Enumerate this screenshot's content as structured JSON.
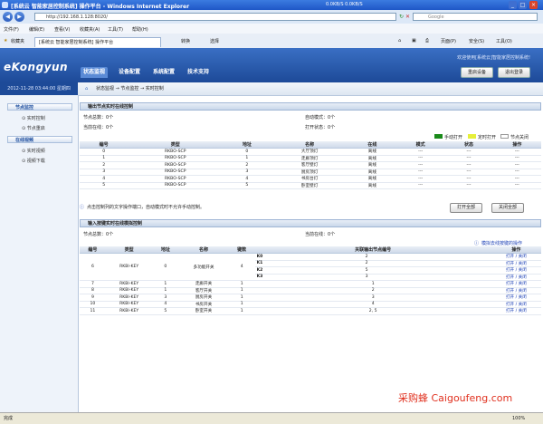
{
  "window": {
    "title": "[系统云 智能家居控制系统] 操作平台 - Windows Internet Explorer",
    "net_status": "0.0KB/S  0.0KB/S"
  },
  "browser": {
    "address": "http://192.168.1.128:8020/",
    "search_placeholder": "Google",
    "menu": [
      "文件(F)",
      "编辑(E)",
      "查看(V)",
      "收藏夹(A)",
      "工具(T)",
      "帮助(H)"
    ],
    "favorites_label": "收藏夹",
    "tab_label": "[系统云 智能家居控制系统] 操作平台",
    "tab_tools": [
      "转换",
      "选择"
    ],
    "toolbar_right": [
      "页面(P)",
      "安全(S)",
      "工具(O)"
    ]
  },
  "app": {
    "logo": "eKongyun",
    "nav": [
      "状态监视",
      "设备配置",
      "系统配置",
      "技术支持"
    ],
    "welcome": "欢迎使用[系统云]智能家居控制系统!",
    "buttons": {
      "restart": "重启设备",
      "logout": "退出登录"
    },
    "datetime": "2012-11-28 03:44:00 星期四",
    "breadcrumb": "状态监视 → 节点监控 → 实时控制"
  },
  "sidebar": {
    "groups": [
      {
        "title": "节点监控",
        "items": [
          "实时控制",
          "节点重启"
        ]
      },
      {
        "title": "在线视频",
        "items": [
          "实时视频",
          "视频下载"
        ]
      }
    ]
  },
  "output_panel": {
    "title": "输出节点实时在线控制",
    "total_label": "节点总数：",
    "total_value": "0个",
    "online_label": "当前在线：",
    "online_value": "0个",
    "auto_mode_label": "自动模式：",
    "auto_mode_value": "0个",
    "mode_status_label": "打开状态：",
    "mode_status_value": "0个",
    "legend": [
      {
        "label": "手动打开",
        "color": "#1a8a1a"
      },
      {
        "label": "定时打开",
        "color": "#e6ef3a"
      },
      {
        "label": "节点关闭",
        "color": "#ffffff"
      }
    ],
    "columns": [
      "编号",
      "类型",
      "地址",
      "名称",
      "在线",
      "模式",
      "状态",
      "操作"
    ],
    "rows": [
      [
        "0",
        "RKBO-SCP",
        "0",
        "大厅顶灯",
        "离线",
        "---",
        "---",
        "---"
      ],
      [
        "1",
        "RKBO-SCP",
        "1",
        "走廊顶灯",
        "离线",
        "---",
        "---",
        "---"
      ],
      [
        "2",
        "RKBO-SCP",
        "2",
        "客厅壁灯",
        "离线",
        "---",
        "---",
        "---"
      ],
      [
        "3",
        "RKBO-SCP",
        "3",
        "厨房顶灯",
        "离线",
        "---",
        "---",
        "---"
      ],
      [
        "4",
        "RKBO-SCP",
        "4",
        "书房台灯",
        "离线",
        "---",
        "---",
        "---"
      ],
      [
        "5",
        "RKBO-SCP",
        "5",
        "卧室壁灯",
        "离线",
        "---",
        "---",
        "---"
      ]
    ],
    "hint": "点击控制列的文字操作端口，自动模式时不允许手动控制。",
    "open_all": "打开全部",
    "close_all": "关闭全部"
  },
  "input_panel": {
    "title": "输入按键实时在线模拟控制",
    "total_label": "节点总数：",
    "total_value": "0个",
    "online_label": "当前在线：",
    "online_value": "0个",
    "help_link": "模拟去线按键的操作",
    "columns": [
      "编号",
      "类型",
      "地址",
      "名称",
      "键数",
      "关联输出节点编号",
      "操作"
    ],
    "multi_row": {
      "id": "6",
      "type": "RKBI-KEY",
      "addr": "0",
      "name": "多功能开关",
      "keys": "4",
      "sub": [
        {
          "k": "K0",
          "v": "2"
        },
        {
          "k": "K1",
          "v": "2"
        },
        {
          "k": "K2",
          "v": "5"
        },
        {
          "k": "K3",
          "v": "3"
        }
      ]
    },
    "rows": [
      [
        "7",
        "RKBI-KEY",
        "1",
        "走廊开关",
        "1",
        "1"
      ],
      [
        "8",
        "RKBI-KEY",
        "1",
        "客厅开关",
        "1",
        "2"
      ],
      [
        "9",
        "RKBI-KEY",
        "3",
        "厨房开关",
        "1",
        "3"
      ],
      [
        "10",
        "RKBI-KEY",
        "4",
        "书房开关",
        "1",
        "4"
      ],
      [
        "11",
        "RKBI-KEY",
        "5",
        "卧室开关",
        "1",
        "2, 5"
      ]
    ],
    "action": "打开 / 关闭"
  },
  "status": {
    "left": "完成",
    "zoom": "100%"
  },
  "watermark": "采购蜂 Caigoufeng.com"
}
